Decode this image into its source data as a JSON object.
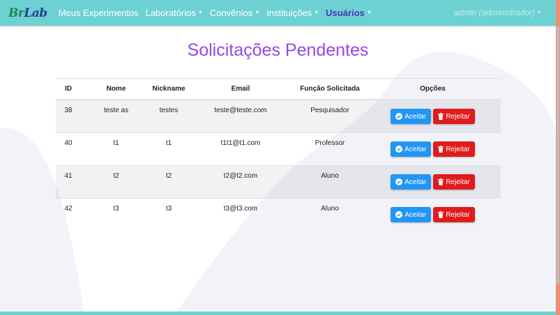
{
  "brand": {
    "part1": "B",
    "part2": "r",
    "part3": "Lab"
  },
  "nav": {
    "items": [
      {
        "label": "Meus Experimentos",
        "dropdown": false,
        "active": false
      },
      {
        "label": "Laboratórios",
        "dropdown": true,
        "active": false
      },
      {
        "label": "Convênios",
        "dropdown": true,
        "active": false
      },
      {
        "label": "Instituições",
        "dropdown": true,
        "active": false
      },
      {
        "label": "Usuários",
        "dropdown": true,
        "active": true
      }
    ],
    "user": "admin (administrador)"
  },
  "page": {
    "title": "Solicitações Pendentes"
  },
  "table": {
    "headers": {
      "id": "ID",
      "name": "Nome",
      "nickname": "Nickname",
      "email": "Email",
      "role": "Função Solicitada",
      "options": "Opções"
    },
    "rows": [
      {
        "id": "38",
        "name": "teste as",
        "nickname": "testes",
        "email": "teste@teste.com",
        "role": "Pesquisador"
      },
      {
        "id": "40",
        "name": "t1",
        "nickname": "t1",
        "email": "t1t1@t1.com",
        "role": "Professor"
      },
      {
        "id": "41",
        "name": "t2",
        "nickname": "t2",
        "email": "t2@t2.com",
        "role": "Aluno"
      },
      {
        "id": "42",
        "name": "t3",
        "nickname": "t3",
        "email": "t3@t3.com",
        "role": "Aluno"
      }
    ],
    "accept_label": "Aceitar",
    "reject_label": "Rejeitar"
  },
  "colors": {
    "navbar": "#6dd1d3",
    "title": "#9548e6",
    "accept": "#2196f3",
    "reject": "#e01b1b",
    "active_nav": "#4e34b4"
  }
}
